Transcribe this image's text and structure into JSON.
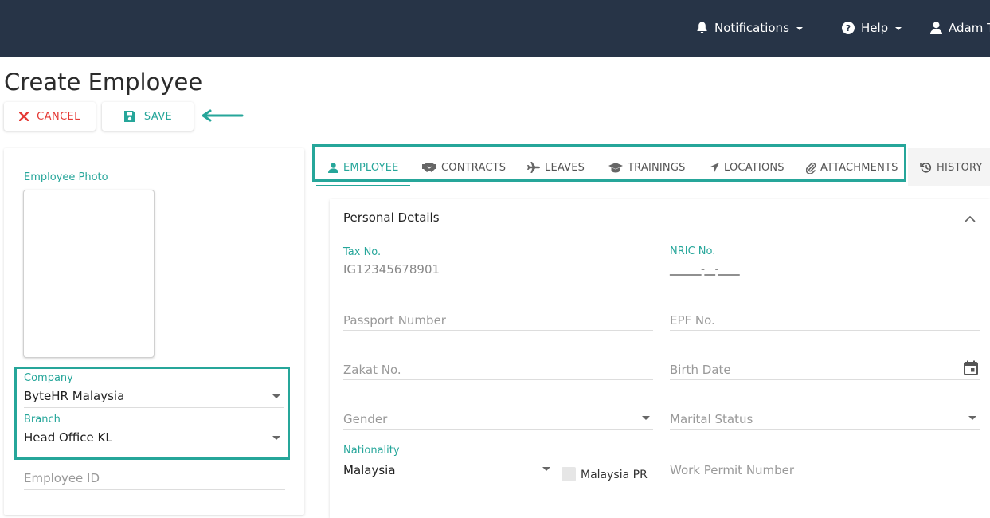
{
  "topbar": {
    "notifications_label": "Notifications",
    "help_label": "Help",
    "user_label": "Adam T",
    "background": "#273447"
  },
  "page": {
    "title": "Create Employee"
  },
  "toolbar": {
    "cancel_label": "CANCEL",
    "save_label": "SAVE"
  },
  "left_panel": {
    "photo_label": "Employee Photo",
    "company_label": "Company",
    "company_value": "ByteHR Malaysia",
    "branch_label": "Branch",
    "branch_value": "Head Office KL",
    "employee_id_placeholder": "Employee ID"
  },
  "tabs": [
    {
      "label": "EMPLOYEE",
      "icon": "person-icon",
      "active": true
    },
    {
      "label": "CONTRACTS",
      "icon": "handshake-icon"
    },
    {
      "label": "LEAVES",
      "icon": "plane-icon"
    },
    {
      "label": "TRAININGS",
      "icon": "graduation-cap-icon"
    },
    {
      "label": "LOCATIONS",
      "icon": "location-arrow-icon"
    },
    {
      "label": "ATTACHMENTS",
      "icon": "paperclip-icon"
    },
    {
      "label": "HISTORY",
      "icon": "history-icon"
    }
  ],
  "personal_details": {
    "title": "Personal Details",
    "tax_label": "Tax No.",
    "tax_value": "IG12345678901",
    "nric_label": "NRIC No.",
    "nric_value": "______-__-____",
    "passport_placeholder": "Passport Number",
    "epf_placeholder": "EPF No.",
    "zakat_placeholder": "Zakat No.",
    "birth_date_placeholder": "Birth Date",
    "gender_placeholder": "Gender",
    "marital_placeholder": "Marital Status",
    "nationality_label": "Nationality",
    "nationality_value": "Malaysia",
    "malaysia_pr_label": "Malaysia PR",
    "work_permit_placeholder": "Work Permit Number"
  },
  "colors": {
    "accent": "#26a69a",
    "danger": "#e53935"
  }
}
